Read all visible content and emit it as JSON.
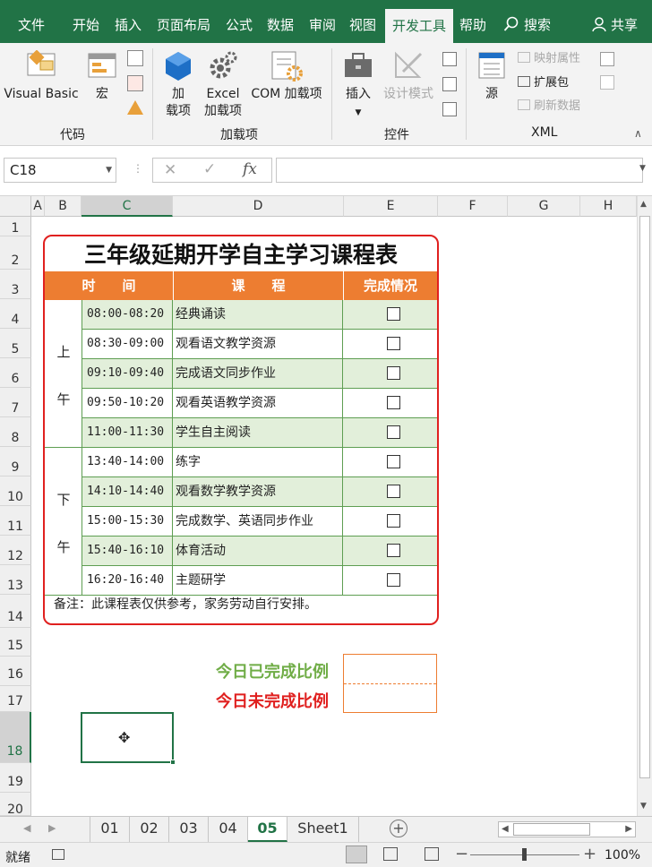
{
  "menu": {
    "tabs": [
      "文件",
      "开始",
      "插入",
      "页面布局",
      "公式",
      "数据",
      "审阅",
      "视图",
      "开发工具",
      "帮助"
    ],
    "active_tab": "开发工具",
    "search_label": "搜索",
    "share_label": "共享"
  },
  "ribbon": {
    "code": {
      "visual_basic": "Visual Basic",
      "macro": "宏",
      "group": "代码"
    },
    "addins": {
      "addin_line1": "加",
      "addin_line2": "载项",
      "excel_line1": "Excel",
      "excel_line2": "加载项",
      "com": "COM 加载项",
      "group": "加载项"
    },
    "controls": {
      "insert": "插入",
      "design_mode": "设计模式",
      "group": "控件"
    },
    "xml": {
      "source": "源",
      "map_props": "映射属性",
      "expansion": "扩展包",
      "refresh": "刷新数据",
      "group": "XML"
    }
  },
  "formula_bar": {
    "name_box": "C18",
    "cancel": "✕",
    "enter": "✓",
    "fx": "fx",
    "formula": ""
  },
  "columns": [
    "A",
    "B",
    "C",
    "D",
    "E",
    "F",
    "G",
    "H"
  ],
  "selected_column": "C",
  "rows": [
    "1",
    "2",
    "3",
    "4",
    "5",
    "6",
    "7",
    "8",
    "9",
    "10",
    "11",
    "12",
    "13",
    "14",
    "15",
    "16",
    "17",
    "18",
    "19",
    "20"
  ],
  "selected_row": "18",
  "schedule": {
    "title": "三年级延期开学自主学习课程表",
    "headers": {
      "time": "时　　间",
      "course": "课　　程",
      "status": "完成情况"
    },
    "morning": [
      "上",
      "午"
    ],
    "afternoon": [
      "下",
      "午"
    ],
    "items": [
      {
        "time": "08:00-08:20",
        "course": "经典诵读"
      },
      {
        "time": "08:30-09:00",
        "course": "观看语文教学资源"
      },
      {
        "time": "09:10-09:40",
        "course": "完成语文同步作业"
      },
      {
        "time": "09:50-10:20",
        "course": "观看英语教学资源"
      },
      {
        "time": "11:00-11:30",
        "course": "学生自主阅读"
      },
      {
        "time": "13:40-14:00",
        "course": "练字"
      },
      {
        "time": "14:10-14:40",
        "course": "观看数学教学资源"
      },
      {
        "time": "15:00-15:30",
        "course": "完成数学、英语同步作业"
      },
      {
        "time": "15:40-16:10",
        "course": "体育活动"
      },
      {
        "time": "16:20-16:40",
        "course": "主题研学"
      }
    ],
    "note": "备注：此课程表仅供参考，家务劳动自行安排。"
  },
  "ratios": {
    "done_label": "今日已完成比例",
    "undone_label": "今日未完成比例",
    "done_color": "#70ad47",
    "undone_color": "#e0201f"
  },
  "sheet_tabs": [
    "01",
    "02",
    "03",
    "04",
    "05",
    "Sheet1"
  ],
  "active_sheet": "05",
  "status": {
    "ready": "就绪",
    "zoom": "100%"
  },
  "colors": {
    "excel_green": "#217346",
    "header_orange": "#ed7d31",
    "row_green": "#e2efda",
    "card_border": "#e0201f"
  }
}
